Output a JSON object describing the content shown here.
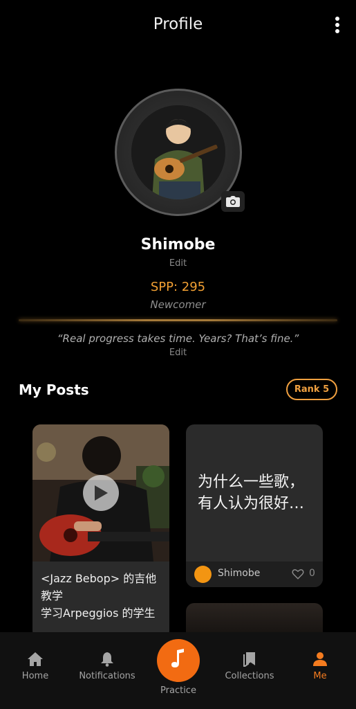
{
  "header": {
    "title": "Profile"
  },
  "profile": {
    "username": "Shimobe",
    "edit_name_label": "Edit",
    "spp": "SPP: 295",
    "level": "Newcomer",
    "quote": "“Real progress takes time. Years? That’s fine.”",
    "edit_quote_label": "Edit"
  },
  "posts": {
    "section_title": "My Posts",
    "rank_label": "Rank 5",
    "items": [
      {
        "title": "<Jazz Bebop> 的吉他教学\n学习Arpeggios 的学生",
        "type": "video"
      },
      {
        "title": "为什么一些歌，有人认为很好…",
        "author": "Shimobe",
        "likes": "0"
      }
    ]
  },
  "tabs": [
    {
      "label": "Home",
      "icon": "home-icon"
    },
    {
      "label": "Notifications",
      "icon": "bell-icon"
    },
    {
      "label": "Practice",
      "icon": "music-note-icon"
    },
    {
      "label": "Collections",
      "icon": "bookmarks-icon"
    },
    {
      "label": "Me",
      "icon": "person-icon",
      "active": true
    }
  ],
  "colors": {
    "accent": "#f26b12",
    "spp": "#f2a033",
    "rank": "#f0a040",
    "background": "#000000"
  }
}
